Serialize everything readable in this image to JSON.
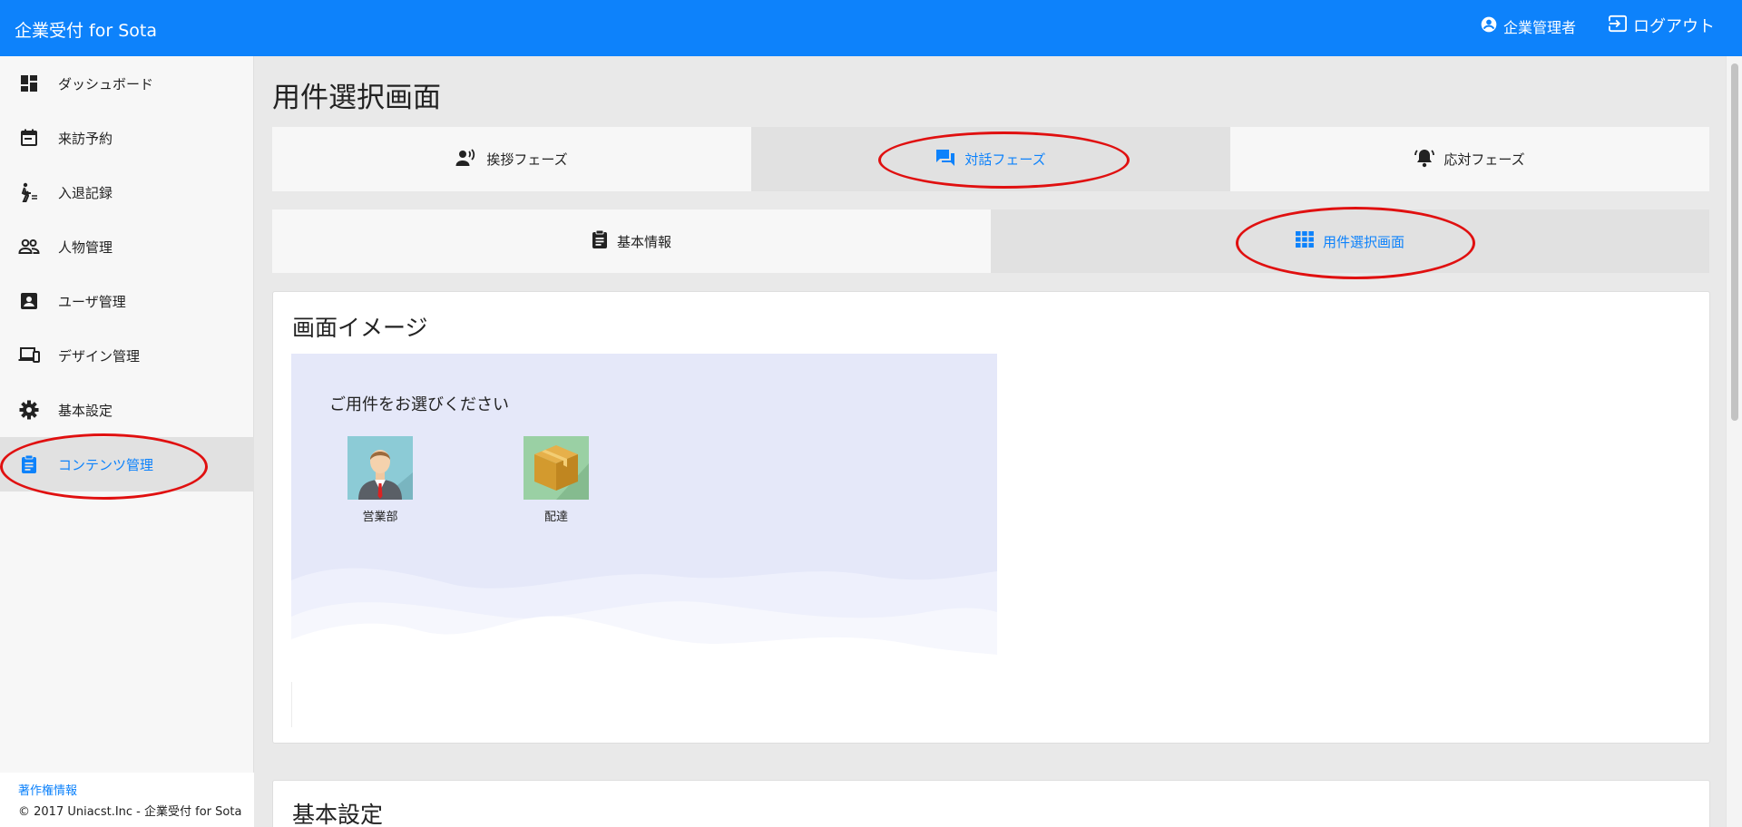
{
  "header": {
    "brand": "企業受付 for Sota",
    "user_label": "企業管理者",
    "logout_label": "ログアウト"
  },
  "sidebar": {
    "items": [
      {
        "label": "ダッシュボード",
        "icon": "dashboard-icon"
      },
      {
        "label": "来訪予約",
        "icon": "calendar-icon"
      },
      {
        "label": "入退記録",
        "icon": "walking-person-icon"
      },
      {
        "label": "人物管理",
        "icon": "people-icon"
      },
      {
        "label": "ユーザ管理",
        "icon": "account-box-icon"
      },
      {
        "label": "デザイン管理",
        "icon": "devices-icon"
      },
      {
        "label": "基本設定",
        "icon": "gear-icon"
      },
      {
        "label": "コンテンツ管理",
        "icon": "clipboard-icon",
        "active": true
      }
    ],
    "footer": {
      "copyright_link": "著作権情報",
      "copyright_text": "© 2017 Uniacst.Inc - 企業受付 for Sota"
    }
  },
  "main": {
    "title": "用件選択画面",
    "phase_tabs": [
      {
        "label": "挨拶フェーズ",
        "icon": "speaking-person-icon"
      },
      {
        "label": "対話フェーズ",
        "icon": "chat-icon",
        "active": true
      },
      {
        "label": "応対フェーズ",
        "icon": "bell-icon"
      }
    ],
    "sub_tabs": [
      {
        "label": "基本情報",
        "icon": "clipboard-icon"
      },
      {
        "label": "用件選択画面",
        "icon": "grid-icon",
        "active": true
      }
    ],
    "image_card": {
      "title": "画面イメージ",
      "preview": {
        "prompt": "ご用件をお選びください",
        "choices": [
          {
            "label": "営業部",
            "icon": "businessman-icon"
          },
          {
            "label": "配達",
            "icon": "package-box-icon"
          }
        ]
      }
    },
    "settings_card": {
      "title": "基本設定"
    }
  },
  "colors": {
    "accent": "#0d82fb",
    "annotation": "#e01010",
    "preview_bg": "#e5e8f9"
  }
}
